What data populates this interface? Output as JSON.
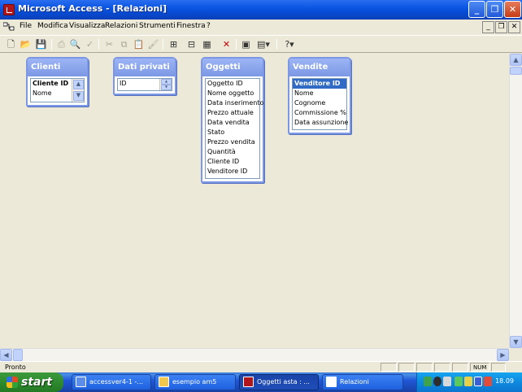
{
  "window": {
    "title": "Microsoft Access - [Relazioni]"
  },
  "menu": {
    "items": [
      "File",
      "Modifica",
      "Visualizza",
      "Relazioni",
      "Strumenti",
      "Finestra",
      "?"
    ]
  },
  "toolbar": {
    "buttons": [
      "new-icon",
      "open-icon",
      "save-icon",
      "print-icon",
      "print-preview-icon",
      "spell-icon",
      "cut-icon",
      "copy-icon",
      "paste-icon",
      "format-painter-icon",
      "show-table-icon",
      "show-direct-icon",
      "show-all-icon",
      "delete-icon",
      "new-object-icon",
      "help-icon"
    ]
  },
  "tables": [
    {
      "name": "Clienti",
      "fields": [
        {
          "label": "Cliente ID",
          "style": "pk"
        },
        {
          "label": "Nome"
        }
      ]
    },
    {
      "name": "Dati privati",
      "fields": [
        {
          "label": "ID"
        }
      ]
    },
    {
      "name": "Oggetti",
      "fields": [
        {
          "label": "Oggetto ID"
        },
        {
          "label": "Nome oggetto"
        },
        {
          "label": "Data inserimento"
        },
        {
          "label": "Prezzo attuale"
        },
        {
          "label": "Data vendita"
        },
        {
          "label": "Stato"
        },
        {
          "label": "Prezzo vendita"
        },
        {
          "label": "Quantità"
        },
        {
          "label": "Cliente ID"
        },
        {
          "label": "Venditore ID"
        }
      ]
    },
    {
      "name": "Vendite",
      "fields": [
        {
          "label": "Venditore ID",
          "style": "selected"
        },
        {
          "label": "Nome"
        },
        {
          "label": "Cognome"
        },
        {
          "label": "Commissione %"
        },
        {
          "label": "Data assunzione"
        }
      ]
    }
  ],
  "statusbar": {
    "text": "Pronto",
    "num": "NUM"
  },
  "taskbar": {
    "start": "start",
    "tasks": [
      "accessver4-1 -...",
      "esempio am5",
      "Oggetti asta : ...",
      "Relazioni"
    ],
    "clock": "18.09"
  }
}
